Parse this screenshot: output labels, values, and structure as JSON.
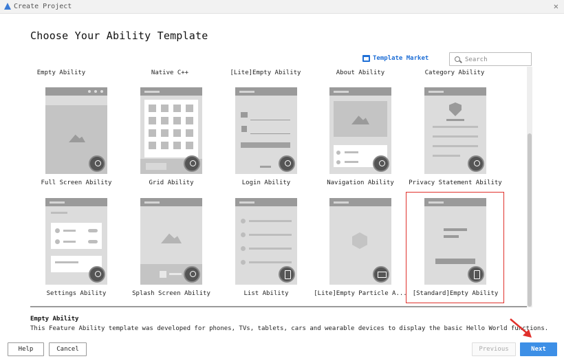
{
  "window": {
    "title": "Create Project"
  },
  "heading": "Choose Your Ability Template",
  "template_market": "Template Market",
  "search": {
    "placeholder": "Search",
    "value": ""
  },
  "top_row_labels": [
    "Empty Ability",
    "Native C++",
    "[Lite]Empty Ability",
    "About Ability",
    "Category Ability"
  ],
  "row1": [
    {
      "label": "Full Screen Ability",
      "badge": "multi-device-icon"
    },
    {
      "label": "Grid Ability",
      "badge": "multi-device-icon"
    },
    {
      "label": "Login Ability",
      "badge": "multi-device-icon"
    },
    {
      "label": "Navigation Ability",
      "badge": "multi-device-icon"
    },
    {
      "label": "Privacy Statement Ability",
      "badge": "multi-device-icon"
    }
  ],
  "row2": [
    {
      "label": "Settings Ability",
      "badge": "multi-device-icon"
    },
    {
      "label": "Splash Screen Ability",
      "badge": "multi-device-icon"
    },
    {
      "label": "List Ability",
      "badge": "phone-icon"
    },
    {
      "label": "[Lite]Empty Particle A...",
      "badge": "tv-icon"
    },
    {
      "label": "[Standard]Empty Ability",
      "badge": "phone-icon"
    }
  ],
  "selected": "[Standard]Empty Ability",
  "description": {
    "title": "Empty Ability",
    "text": "This Feature Ability template was developed for phones, TVs, tablets, cars and wearable devices to display the basic Hello World functions."
  },
  "buttons": {
    "help": "Help",
    "cancel": "Cancel",
    "previous": "Previous",
    "next": "Next"
  },
  "colors": {
    "accent": "#3d8fe6",
    "selection": "#e0302b",
    "link": "#1f6fd6"
  }
}
